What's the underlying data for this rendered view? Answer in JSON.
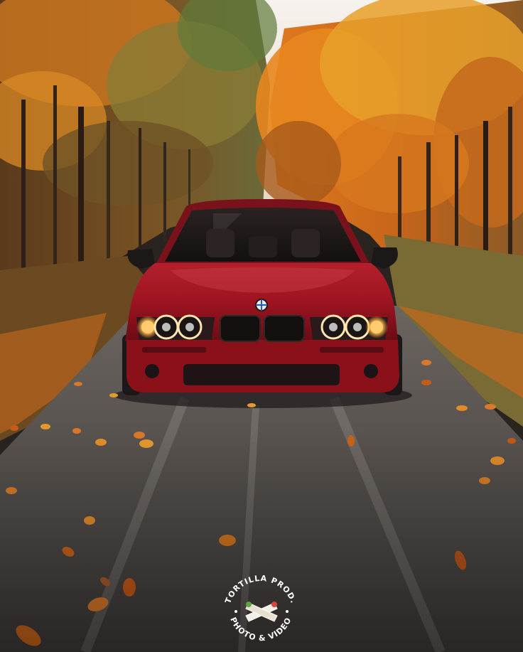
{
  "scene": {
    "subject": "red sedan on a leaf-covered forest road",
    "colors": {
      "sky": "#f4efe9",
      "foliage_orange": "#e0781c",
      "foliage_gold": "#e3a12a",
      "foliage_green": "#6f7a3a",
      "trunks": "#3b2a20",
      "road": "#55514e",
      "road_edge_leaves": "#b8641c",
      "car_body": "#9c1420",
      "car_shadow": "#5a0b12",
      "headlight_glow": "#ffb347"
    }
  },
  "watermark": {
    "top_text": "TORTILLA PROD.",
    "bottom_text": "PHOTO & VIDEO",
    "icon": "tortilla-wrap-icon"
  }
}
